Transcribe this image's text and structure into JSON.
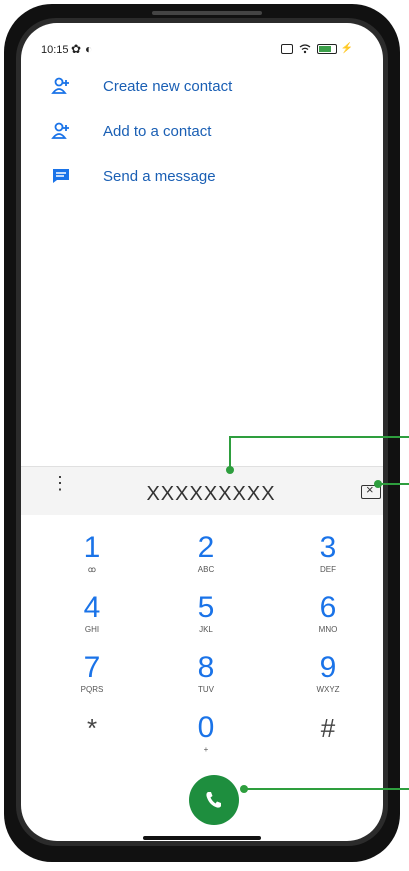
{
  "status_bar": {
    "time": "10:15",
    "gear_glyph": "✿",
    "app_glyph": "◐"
  },
  "actions": [
    {
      "label": "Create new contact",
      "icon": "add-person-icon"
    },
    {
      "label": "Add to a contact",
      "icon": "add-person-icon"
    },
    {
      "label": "Send a message",
      "icon": "message-icon"
    }
  ],
  "dialer": {
    "number": "XXXXXXXXX",
    "overflow_glyph": "⋮",
    "keys": [
      {
        "digit": "1",
        "letters": "ꝏ"
      },
      {
        "digit": "2",
        "letters": "ABC"
      },
      {
        "digit": "3",
        "letters": "DEF"
      },
      {
        "digit": "4",
        "letters": "GHI"
      },
      {
        "digit": "5",
        "letters": "JKL"
      },
      {
        "digit": "6",
        "letters": "MNO"
      },
      {
        "digit": "7",
        "letters": "PQRS"
      },
      {
        "digit": "8",
        "letters": "TUV"
      },
      {
        "digit": "9",
        "letters": "WXYZ"
      },
      {
        "digit": "*",
        "letters": ""
      },
      {
        "digit": "0",
        "letters": "+"
      },
      {
        "digit": "#",
        "letters": ""
      }
    ]
  },
  "colors": {
    "accent": "#1a73e8",
    "call_green": "#1e8e3e",
    "callout_green": "#2e9e3e"
  }
}
